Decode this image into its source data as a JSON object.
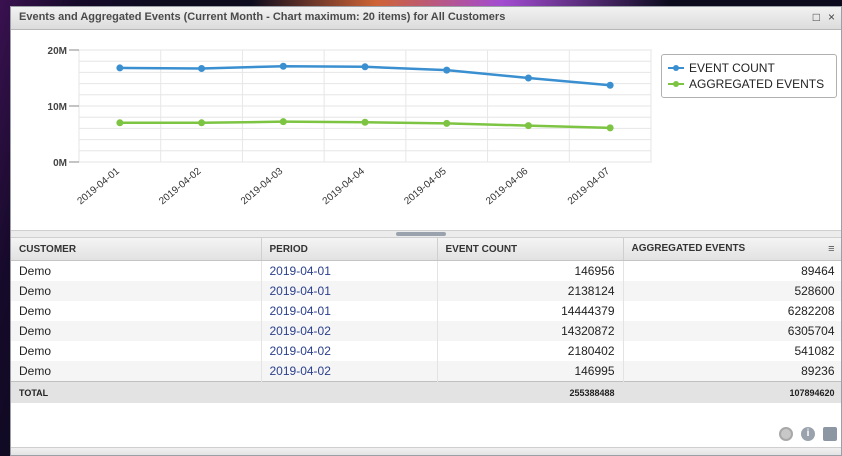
{
  "window": {
    "title": "Events and Aggregated Events (Current Month - Chart maximum: 20 items) for All Customers",
    "maximize_icon": "□",
    "close_icon": "×"
  },
  "chart_data": {
    "type": "line",
    "x": [
      "2019-04-01",
      "2019-04-02",
      "2019-04-03",
      "2019-04-04",
      "2019-04-05",
      "2019-04-06",
      "2019-04-07"
    ],
    "series": [
      {
        "name": "EVENT COUNT",
        "values": [
          16.8,
          16.7,
          17.1,
          17.0,
          16.4,
          15.0,
          13.7
        ],
        "color": "#3a8fd0"
      },
      {
        "name": "AGGREGATED EVENTS",
        "values": [
          7.0,
          7.0,
          7.2,
          7.1,
          6.9,
          6.5,
          6.1
        ],
        "color": "#7cc442"
      }
    ],
    "yticks": [
      "0M",
      "10M",
      "20M"
    ],
    "ylim": [
      0,
      20
    ],
    "legend": "top-right",
    "grid": true
  },
  "table": {
    "columns": [
      "CUSTOMER",
      "PERIOD",
      "EVENT COUNT",
      "AGGREGATED EVENTS"
    ],
    "column_menu_icon": "≡",
    "rows": [
      [
        "Demo",
        "2019-04-01",
        "146956",
        "89464"
      ],
      [
        "Demo",
        "2019-04-01",
        "2138124",
        "528600"
      ],
      [
        "Demo",
        "2019-04-01",
        "14444379",
        "6282208"
      ],
      [
        "Demo",
        "2019-04-02",
        "14320872",
        "6305704"
      ],
      [
        "Demo",
        "2019-04-02",
        "2180402",
        "541082"
      ],
      [
        "Demo",
        "2019-04-02",
        "146995",
        "89236"
      ]
    ],
    "total": {
      "label": "TOTAL",
      "event_count": "255388488",
      "aggregated_events": "107894620"
    }
  },
  "footer": {
    "icons": [
      "settings-icon",
      "info-icon",
      "save-icon"
    ],
    "info_glyph": "i"
  }
}
